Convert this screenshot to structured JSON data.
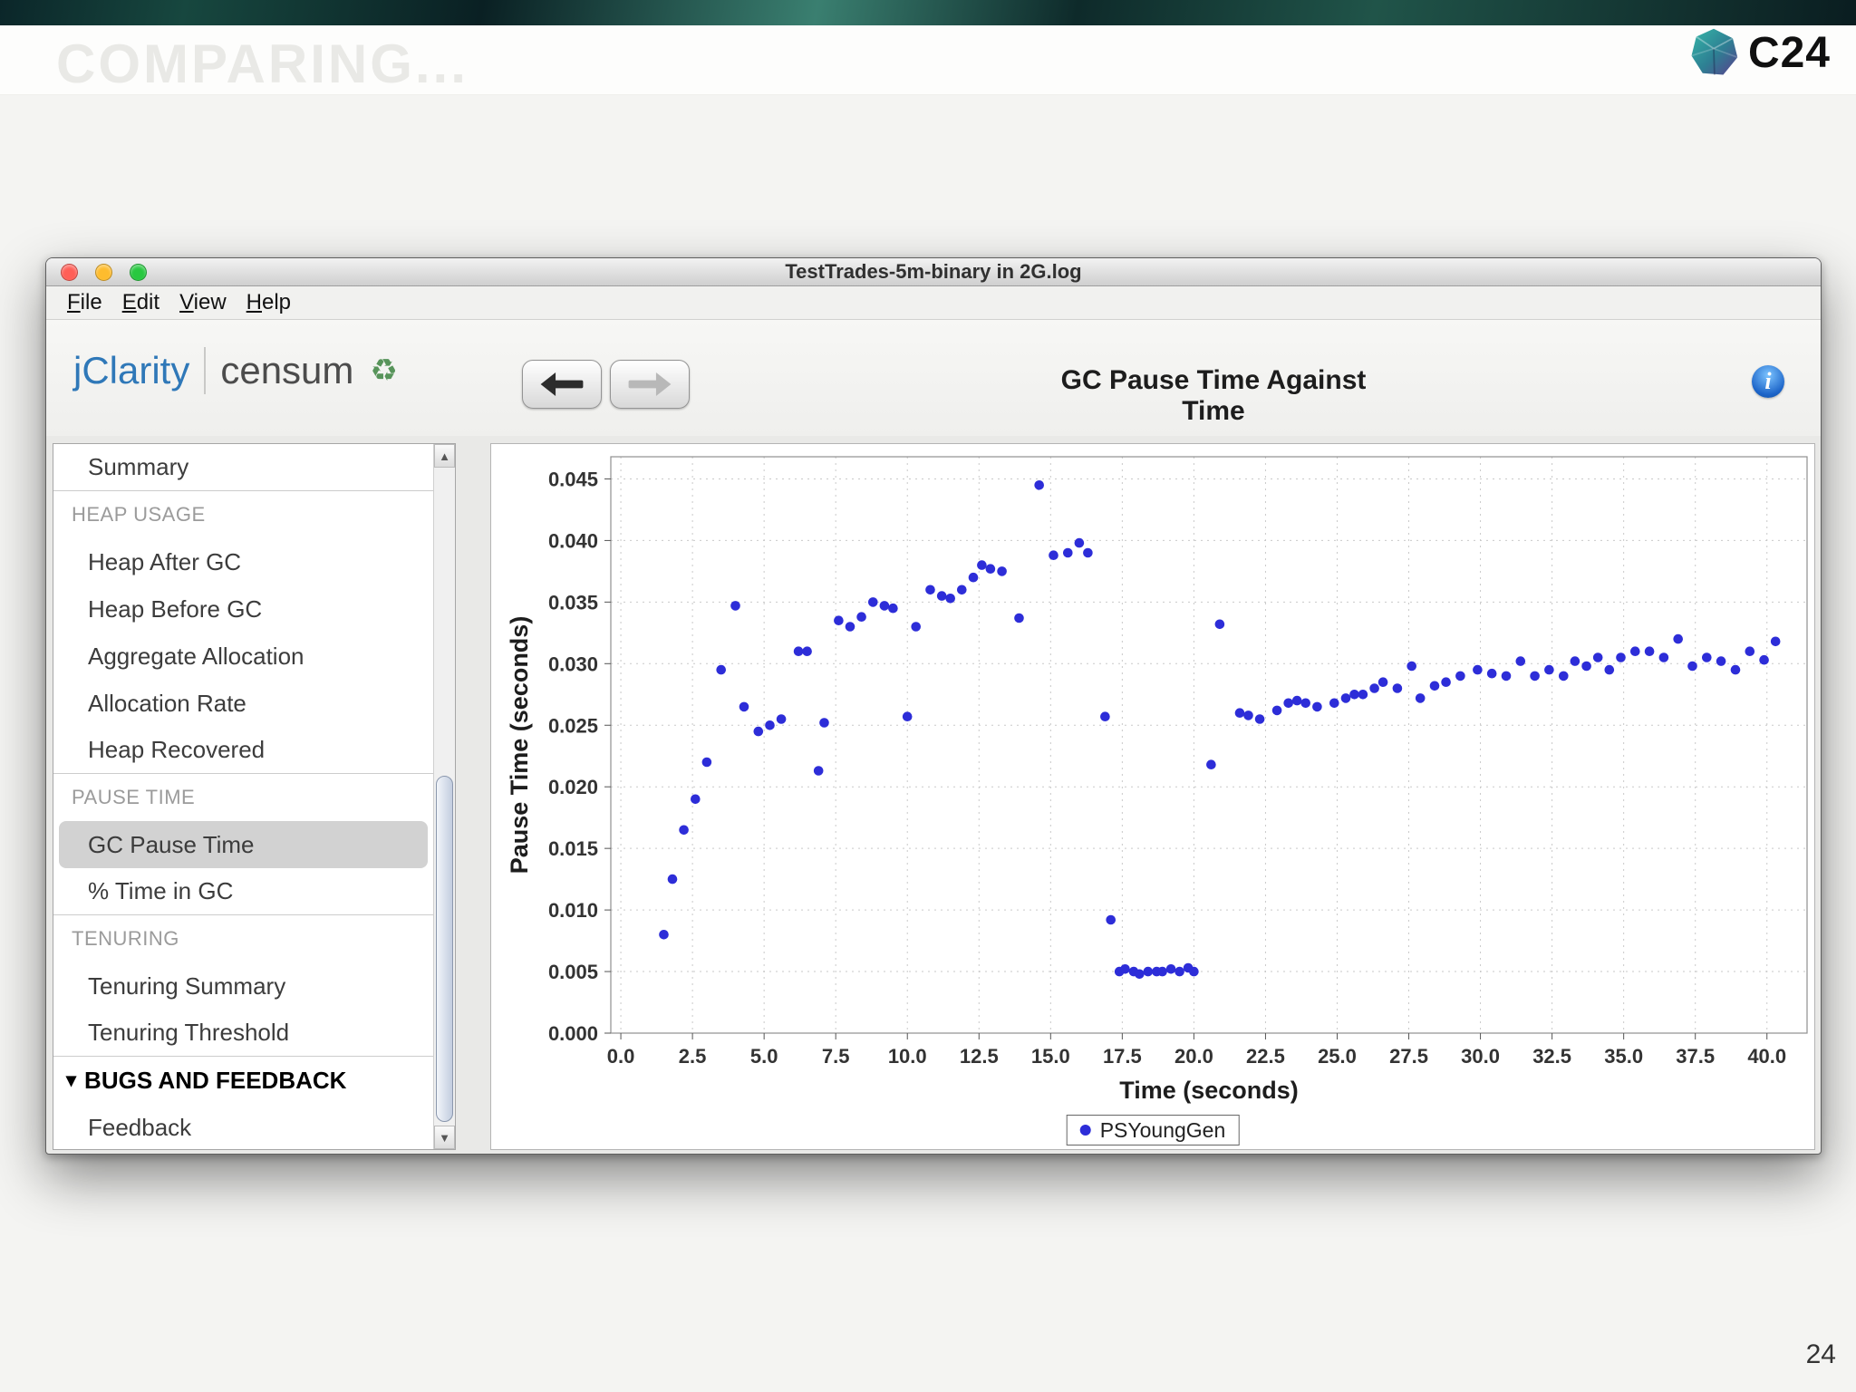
{
  "slide": {
    "ghost_title": "COMPARING...",
    "logo_text": "C24",
    "page_number": "24"
  },
  "icons": {
    "disclosure": "▾",
    "scroll_up": "▲",
    "scroll_down": "▼",
    "info": "i",
    "recycle": "♻"
  },
  "colors": {
    "brand_blue": "#2f78b8",
    "point_blue": "#2d2dd8",
    "traffic_close": "#ff5f57",
    "traffic_min": "#febc2e",
    "traffic_zoom": "#28c840"
  },
  "window": {
    "title": "TestTrades-5m-binary in 2G.log",
    "menu": [
      "File",
      "Edit",
      "View",
      "Help"
    ],
    "toolbar": {
      "brand_primary": "jClarity",
      "brand_secondary": "censum",
      "heading": "GC Pause Time Against Time"
    },
    "sidebar": [
      {
        "type": "item",
        "label": "Summary",
        "divider": true
      },
      {
        "type": "header",
        "label": "HEAP USAGE"
      },
      {
        "type": "item",
        "label": "Heap After GC"
      },
      {
        "type": "item",
        "label": "Heap Before GC"
      },
      {
        "type": "item",
        "label": "Aggregate Allocation"
      },
      {
        "type": "item",
        "label": "Allocation Rate"
      },
      {
        "type": "item",
        "label": "Heap Recovered",
        "divider": true
      },
      {
        "type": "header",
        "label": "PAUSE TIME"
      },
      {
        "type": "item",
        "label": "GC Pause Time",
        "selected": true
      },
      {
        "type": "item",
        "label": "% Time in GC",
        "divider": true
      },
      {
        "type": "header",
        "label": "TENURING"
      },
      {
        "type": "item",
        "label": "Tenuring Summary"
      },
      {
        "type": "item",
        "label": "Tenuring Threshold",
        "divider": true
      },
      {
        "type": "section",
        "label": "BUGS AND FEEDBACK"
      },
      {
        "type": "item",
        "label": "Feedback"
      }
    ]
  },
  "chart_data": {
    "type": "scatter",
    "title": "GC Pause Time Against Time",
    "xlabel": "Time (seconds)",
    "ylabel": "Pause Time (seconds)",
    "grid": true,
    "legend_position": "bottom",
    "xlim": [
      -0.35,
      41.4
    ],
    "ylim": [
      0,
      0.0468
    ],
    "xticks": [
      0,
      2.5,
      5,
      7.5,
      10,
      12.5,
      15,
      17.5,
      20,
      22.5,
      25,
      27.5,
      30,
      32.5,
      35,
      37.5,
      40
    ],
    "yticks": [
      0,
      0.005,
      0.01,
      0.015,
      0.02,
      0.025,
      0.03,
      0.035,
      0.04,
      0.045
    ],
    "point_color": "#2d2dd8",
    "series": [
      {
        "name": "PSYoungGen",
        "x": [
          1.5,
          1.8,
          2.2,
          2.6,
          3.0,
          3.5,
          4.0,
          4.3,
          4.8,
          5.2,
          5.6,
          6.2,
          6.5,
          6.9,
          7.1,
          7.6,
          8.0,
          8.4,
          8.8,
          9.2,
          9.5,
          10.0,
          10.3,
          10.8,
          11.2,
          11.5,
          11.9,
          12.3,
          12.6,
          12.9,
          13.3,
          13.9,
          14.6,
          15.1,
          15.6,
          16.0,
          16.3,
          16.9,
          17.1,
          17.4,
          17.6,
          17.9,
          18.1,
          18.4,
          18.7,
          18.9,
          19.2,
          19.5,
          19.8,
          20.0,
          20.6,
          20.9,
          21.6,
          21.9,
          22.3,
          22.9,
          23.3,
          23.6,
          23.9,
          24.3,
          24.9,
          25.3,
          25.6,
          25.9,
          26.3,
          26.6,
          27.1,
          27.6,
          27.9,
          28.4,
          28.8,
          29.3,
          29.9,
          30.4,
          30.9,
          31.4,
          31.9,
          32.4,
          32.9,
          33.3,
          33.7,
          34.1,
          34.5,
          34.9,
          35.4,
          35.9,
          36.4,
          36.9,
          37.4,
          37.9,
          38.4,
          38.9,
          39.4,
          39.9,
          40.3
        ],
        "y": [
          0.008,
          0.0125,
          0.0165,
          0.019,
          0.022,
          0.0295,
          0.0347,
          0.0265,
          0.0245,
          0.025,
          0.0255,
          0.031,
          0.031,
          0.0213,
          0.0252,
          0.0335,
          0.033,
          0.0338,
          0.035,
          0.0347,
          0.0345,
          0.0257,
          0.033,
          0.036,
          0.0355,
          0.0353,
          0.036,
          0.037,
          0.038,
          0.0377,
          0.0375,
          0.0337,
          0.0445,
          0.0388,
          0.039,
          0.0398,
          0.039,
          0.0257,
          0.0092,
          0.005,
          0.0052,
          0.005,
          0.0048,
          0.005,
          0.005,
          0.005,
          0.0052,
          0.005,
          0.0053,
          0.005,
          0.0218,
          0.0332,
          0.026,
          0.0258,
          0.0255,
          0.0262,
          0.0268,
          0.027,
          0.0268,
          0.0265,
          0.0268,
          0.0272,
          0.0275,
          0.0275,
          0.028,
          0.0285,
          0.028,
          0.0298,
          0.0272,
          0.0282,
          0.0285,
          0.029,
          0.0295,
          0.0292,
          0.029,
          0.0302,
          0.029,
          0.0295,
          0.029,
          0.0302,
          0.0298,
          0.0305,
          0.0295,
          0.0305,
          0.031,
          0.031,
          0.0305,
          0.032,
          0.0298,
          0.0305,
          0.0302,
          0.0295,
          0.031,
          0.0303,
          0.0318
        ]
      }
    ]
  }
}
